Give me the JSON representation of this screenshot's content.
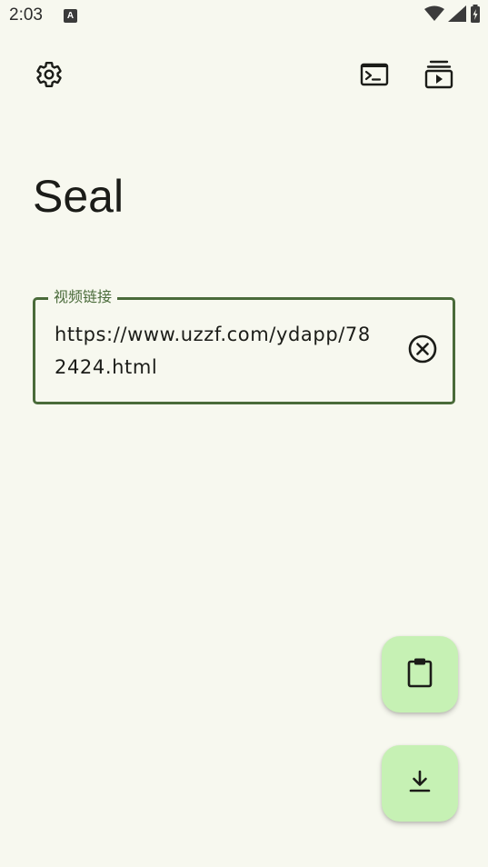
{
  "status_bar": {
    "time": "2:03",
    "notification_icon": "A"
  },
  "top_bar": {
    "settings_icon": "gear-icon",
    "terminal_icon": "terminal-icon",
    "queue_icon": "download-queue-icon"
  },
  "app": {
    "title": "Seal"
  },
  "url_field": {
    "label": "视频链接",
    "value": "https://www.uzzf.com/ydapp/782424.html",
    "clear_icon": "clear-circle-icon"
  },
  "fabs": {
    "paste_icon": "clipboard-icon",
    "download_icon": "download-icon"
  },
  "colors": {
    "background": "#f7f8ef",
    "accent": "#4a6b3a",
    "fab_background": "#c6f1b4",
    "text": "#1b1c18"
  }
}
